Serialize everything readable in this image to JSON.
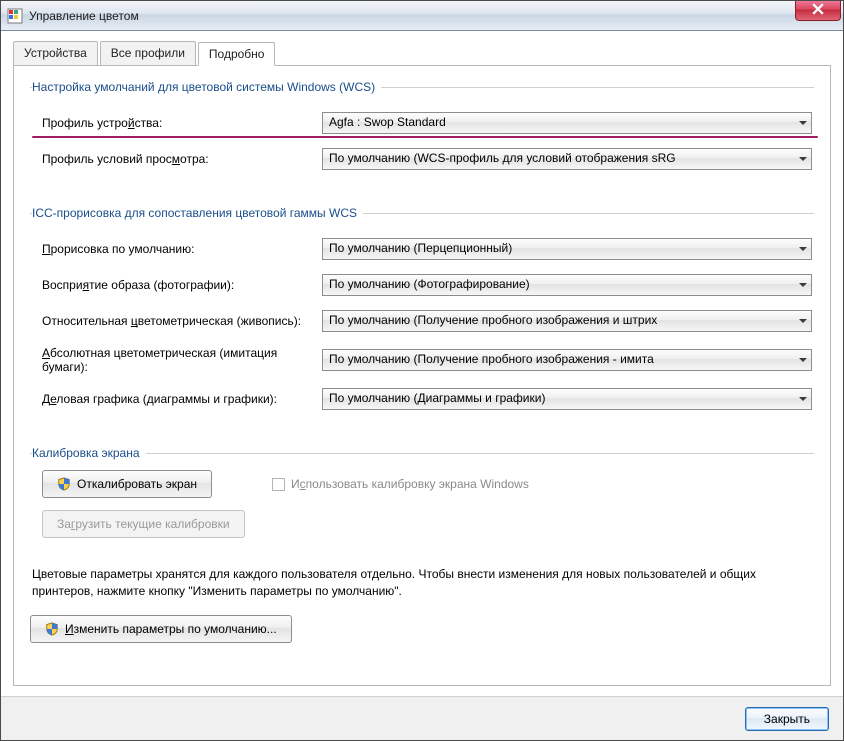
{
  "window": {
    "title": "Управление цветом"
  },
  "tabs": {
    "devices": "Устройства",
    "all_profiles": "Все профили",
    "advanced": "Подробно"
  },
  "group_wcs": {
    "legend": "Настройка умолчаний для цветовой системы Windows (WCS)",
    "device_profile_label": "Профиль устройства:",
    "device_profile_value": "Agfa : Swop Standard",
    "viewing_label": "Профиль условий просмотра:",
    "viewing_value": "По умолчанию (WCS-профиль для условий отображения sRG"
  },
  "group_icc": {
    "legend": "ICC-прорисовка для сопоставления цветовой гаммы WCS",
    "default_intent_label": "Прорисовка по умолчанию:",
    "default_intent_value": "По умолчанию (Перцепционный)",
    "perception_label": "Восприятие образа (фотографии):",
    "perception_value": "По умолчанию (Фотографирование)",
    "relative_label": "Относительная цветометрическая (живопись):",
    "relative_value": "По умолчанию (Получение пробного изображения и штрих",
    "absolute_label": "Абсолютная цветометрическая (имитация бумаги):",
    "absolute_value": "По умолчанию (Получение пробного изображения - имита",
    "business_label": "Деловая графика (диаграммы и графики):",
    "business_value": "По умолчанию (Диаграммы и графики)"
  },
  "group_calib": {
    "legend": "Калибровка экрана",
    "calibrate_btn": "Откалибровать экран",
    "use_windows_calib": "Использовать калибровку экрана Windows",
    "load_current": "Загрузить текущие калибровки"
  },
  "bottom_text": "Цветовые параметры хранятся для каждого пользователя отдельно. Чтобы внести изменения для новых пользователей и общих принтеров, нажмите кнопку \"Изменить параметры по умолчанию\".",
  "change_defaults_btn": "Изменить параметры по умолчанию...",
  "footer": {
    "close": "Закрыть"
  }
}
